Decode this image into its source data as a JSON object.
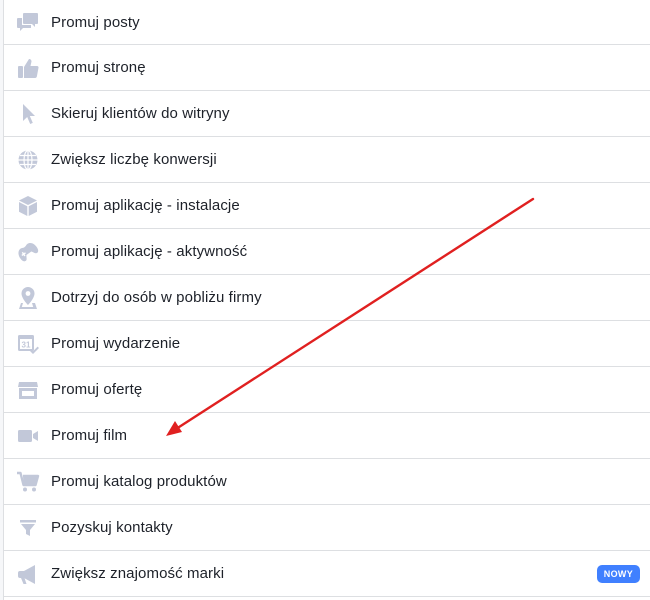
{
  "objectives": {
    "items": [
      {
        "label": "Promuj posty",
        "icon": "chat-bubbles-icon"
      },
      {
        "label": "Promuj stronę",
        "icon": "thumbs-up-icon"
      },
      {
        "label": "Skieruj klientów do witryny",
        "icon": "cursor-icon"
      },
      {
        "label": "Zwiększ liczbę konwersji",
        "icon": "globe-icon"
      },
      {
        "label": "Promuj aplikację - instalacje",
        "icon": "box-icon"
      },
      {
        "label": "Promuj aplikację - aktywność",
        "icon": "gamepad-icon"
      },
      {
        "label": "Dotrzyj do osób w pobliżu firmy",
        "icon": "map-pin-icon"
      },
      {
        "label": "Promuj wydarzenie",
        "icon": "calendar-icon",
        "calendar_day": "31"
      },
      {
        "label": "Promuj ofertę",
        "icon": "storefront-icon"
      },
      {
        "label": "Promuj film",
        "icon": "video-camera-icon"
      },
      {
        "label": "Promuj katalog produktów",
        "icon": "shopping-cart-icon"
      },
      {
        "label": "Pozyskuj kontakty",
        "icon": "funnel-icon"
      },
      {
        "label": "Zwiększ znajomość marki",
        "icon": "megaphone-icon",
        "badge": "NOWY"
      }
    ]
  },
  "colors": {
    "icon": "#c2c8d9",
    "text": "#1d2129",
    "divider": "#dddfe2",
    "badge": "#4080ff",
    "arrow": "#e02020"
  }
}
